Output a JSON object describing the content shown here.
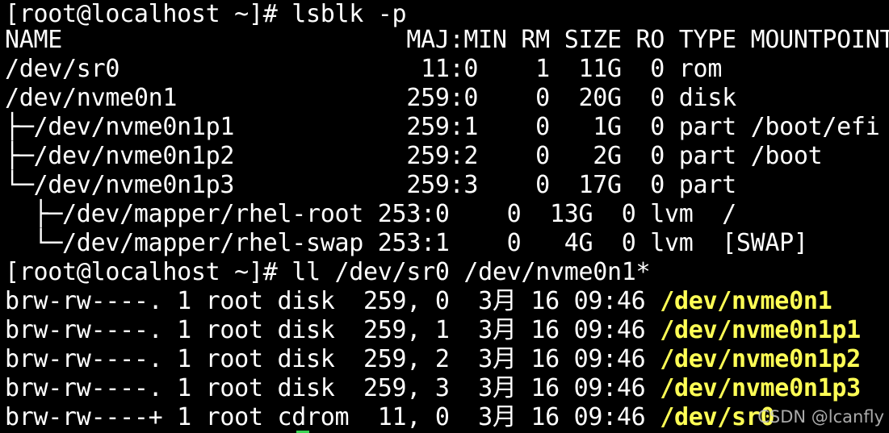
{
  "terminal": {
    "lines": [
      {
        "text": "[root@localhost ~]# lsblk -p"
      },
      {
        "text": "NAME                        MAJ:MIN RM SIZE RO TYPE MOUNTPOINTS"
      },
      {
        "text": "/dev/sr0                     11:0    1  11G  0 rom"
      },
      {
        "text": "/dev/nvme0n1                259:0    0  20G  0 disk"
      },
      {
        "text": "├─/dev/nvme0n1p1            259:1    0   1G  0 part /boot/efi"
      },
      {
        "text": "├─/dev/nvme0n1p2            259:2    0   2G  0 part /boot"
      },
      {
        "text": "└─/dev/nvme0n1p3            259:3    0  17G  0 part"
      },
      {
        "text": "  ├─/dev/mapper/rhel-root 253:0    0  13G  0 lvm  /"
      },
      {
        "text": "  └─/dev/mapper/rhel-swap 253:1    0   4G  0 lvm  [SWAP]"
      },
      {
        "text": "[root@localhost ~]# ll /dev/sr0 /dev/nvme0n1*"
      },
      {
        "text": "brw-rw----. 1 root disk  259, 0  3月 16 09:46 ",
        "highlight": "/dev/nvme0n1"
      },
      {
        "text": "brw-rw----. 1 root disk  259, 1  3月 16 09:46 ",
        "highlight": "/dev/nvme0n1p1"
      },
      {
        "text": "brw-rw----. 1 root disk  259, 2  3月 16 09:46 ",
        "highlight": "/dev/nvme0n1p2"
      },
      {
        "text": "brw-rw----. 1 root disk  259, 3  3月 16 09:46 ",
        "highlight": "/dev/nvme0n1p3"
      },
      {
        "text": "brw-rw----+ 1 root cdrom  11, 0  3月 16 09:46 ",
        "highlight": "/dev/sr0"
      }
    ],
    "colors": {
      "background": "#000000",
      "text": "#ffffff",
      "highlight": "#ffff55"
    }
  },
  "watermark": {
    "text": "CSDN @lcanfly"
  }
}
